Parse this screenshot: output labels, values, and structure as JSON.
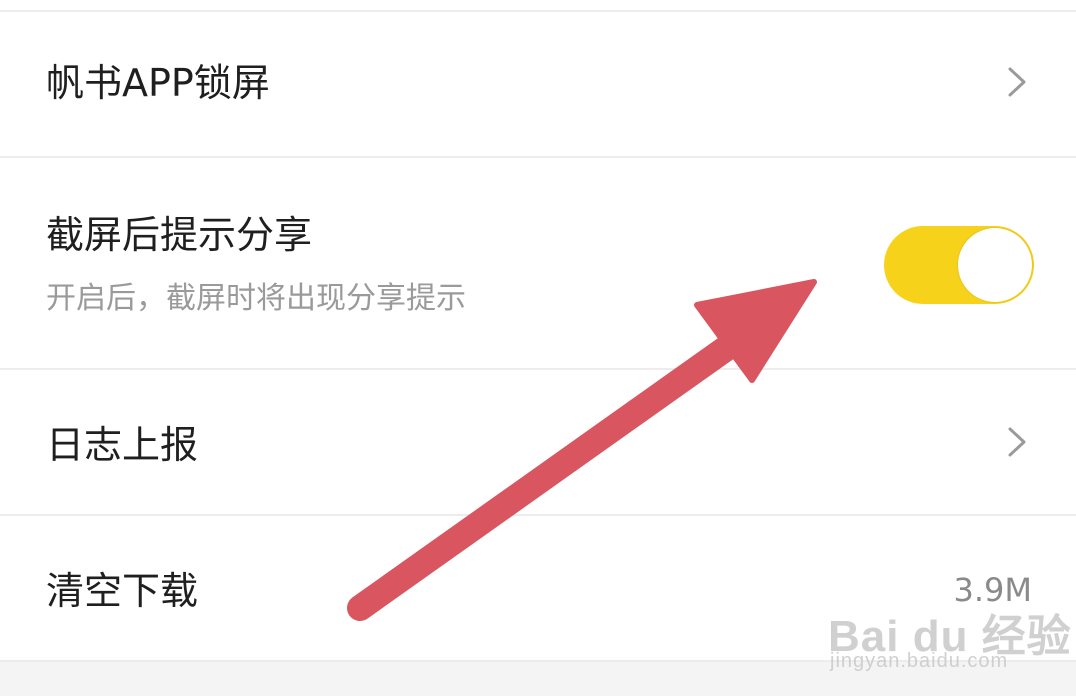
{
  "settings": {
    "rows": [
      {
        "title": "帆书APP锁屏",
        "control": "chevron"
      },
      {
        "title": "截屏后提示分享",
        "subtitle": "开启后，截屏时将出现分享提示",
        "control": "toggle",
        "toggle_on": true
      },
      {
        "title": "日志上报",
        "control": "chevron"
      },
      {
        "title": "清空下载",
        "value": "3.9M",
        "control": "value"
      }
    ]
  },
  "watermark": {
    "logo_text": "Bai du 经验",
    "url_text": "jingyan.baidu.com"
  },
  "colors": {
    "toggle_on": "#f7d21b",
    "arrow": "#d95560",
    "divider": "#ececec",
    "title_text": "#1f1f1f",
    "subtitle_text": "#9a9a9a"
  },
  "icons": {
    "chevron": "chevron-right-icon",
    "annotation": "red-arrow-icon"
  }
}
